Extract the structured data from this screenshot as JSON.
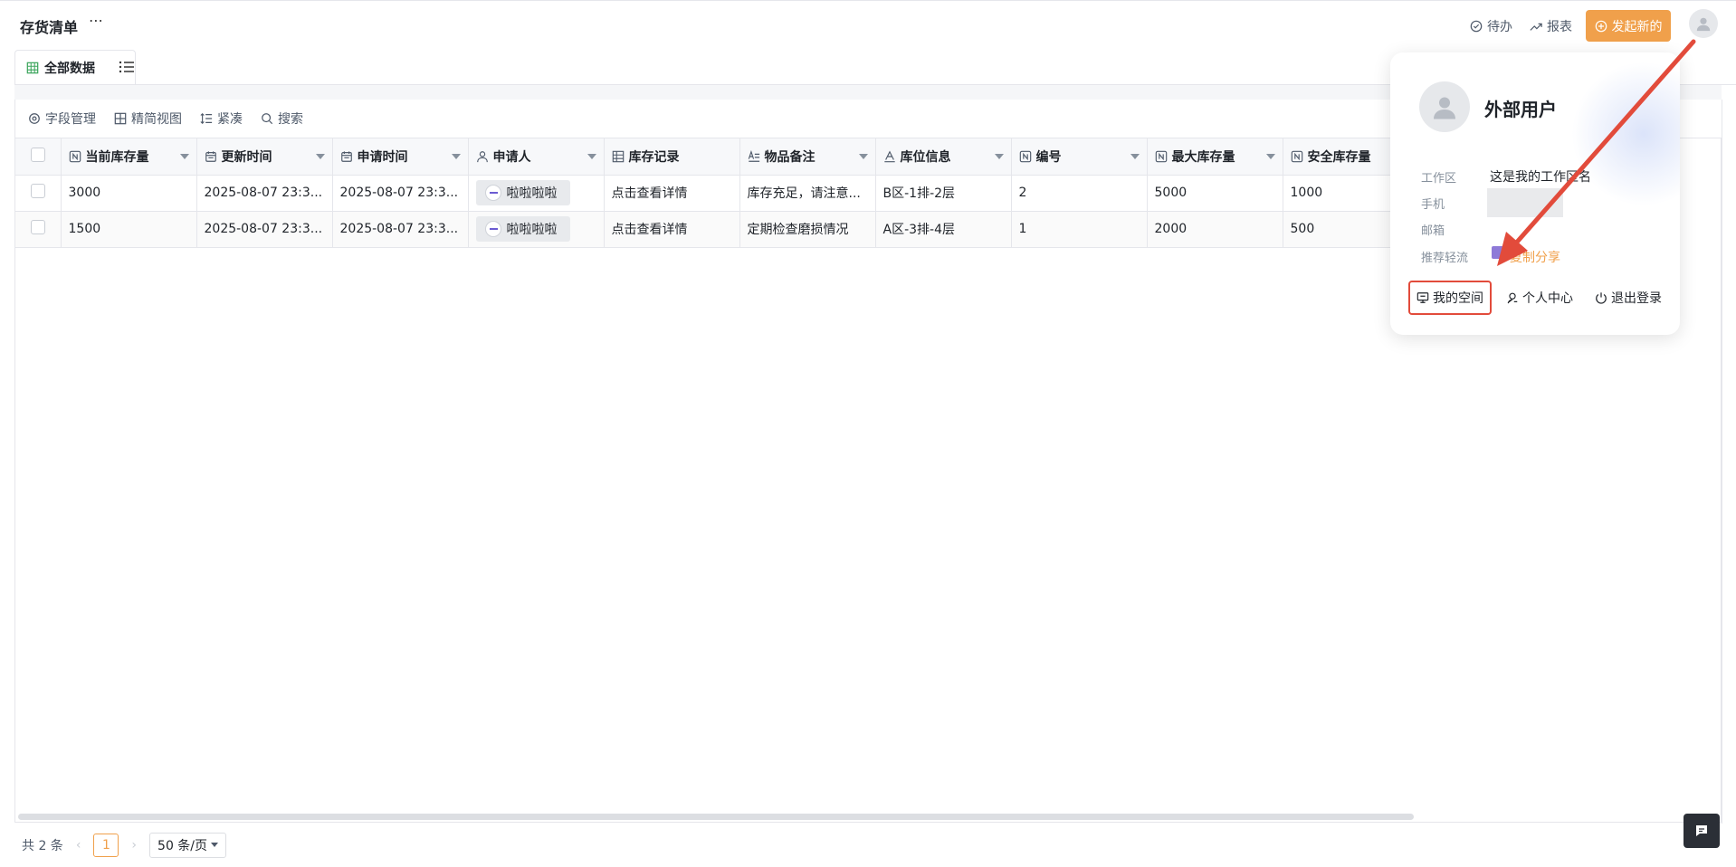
{
  "header": {
    "title": "存货清单",
    "more_icon": "⋯",
    "todo_label": "待办",
    "report_label": "报表",
    "new_label": "发起新的"
  },
  "tabs": {
    "all_data_label": "全部数据"
  },
  "toolbar": {
    "field_manage": "字段管理",
    "compact_view": "精简视图",
    "density": "紧凑",
    "search": "搜索"
  },
  "table": {
    "columns": [
      {
        "label": "当前库存量",
        "icon": "number-icon"
      },
      {
        "label": "更新时间",
        "icon": "calendar-icon"
      },
      {
        "label": "申请时间",
        "icon": "calendar-icon"
      },
      {
        "label": "申请人",
        "icon": "person-icon"
      },
      {
        "label": "库存记录",
        "icon": "table-icon"
      },
      {
        "label": "物品备注",
        "icon": "multiline-text-icon"
      },
      {
        "label": "库位信息",
        "icon": "text-icon"
      },
      {
        "label": "编号",
        "icon": "number-icon"
      },
      {
        "label": "最大库存量",
        "icon": "number-icon"
      },
      {
        "label": "安全库存量",
        "icon": "number-icon"
      }
    ],
    "rows": [
      [
        "3000",
        "2025-08-07 23:3...",
        "2025-08-07 23:3...",
        "啦啦啦啦",
        "点击查看详情",
        "库存充足，请注意...",
        "B区-1排-2层",
        "2",
        "5000",
        "1000"
      ],
      [
        "1500",
        "2025-08-07 23:3...",
        "2025-08-07 23:3...",
        "啦啦啦啦",
        "点击查看详情",
        "定期检查磨损情况",
        "A区-3排-4层",
        "1",
        "2000",
        "500"
      ]
    ]
  },
  "pager": {
    "total": "共 2 条",
    "prev": "‹",
    "page": "1",
    "next": "›",
    "page_size": "50 条/页"
  },
  "popover": {
    "user_name": "外部用户",
    "workspace_label": "工作区",
    "workspace_value": "这是我的工作区名",
    "phone_label": "手机",
    "email_label": "邮箱",
    "recommend_label": "推荐轻流",
    "recommend_link": "复制分享",
    "my_space": "我的空间",
    "personal_center": "个人中心",
    "logout": "退出登录"
  },
  "colors": {
    "accent": "#f0a04b",
    "highlight": "#e24b3b"
  }
}
